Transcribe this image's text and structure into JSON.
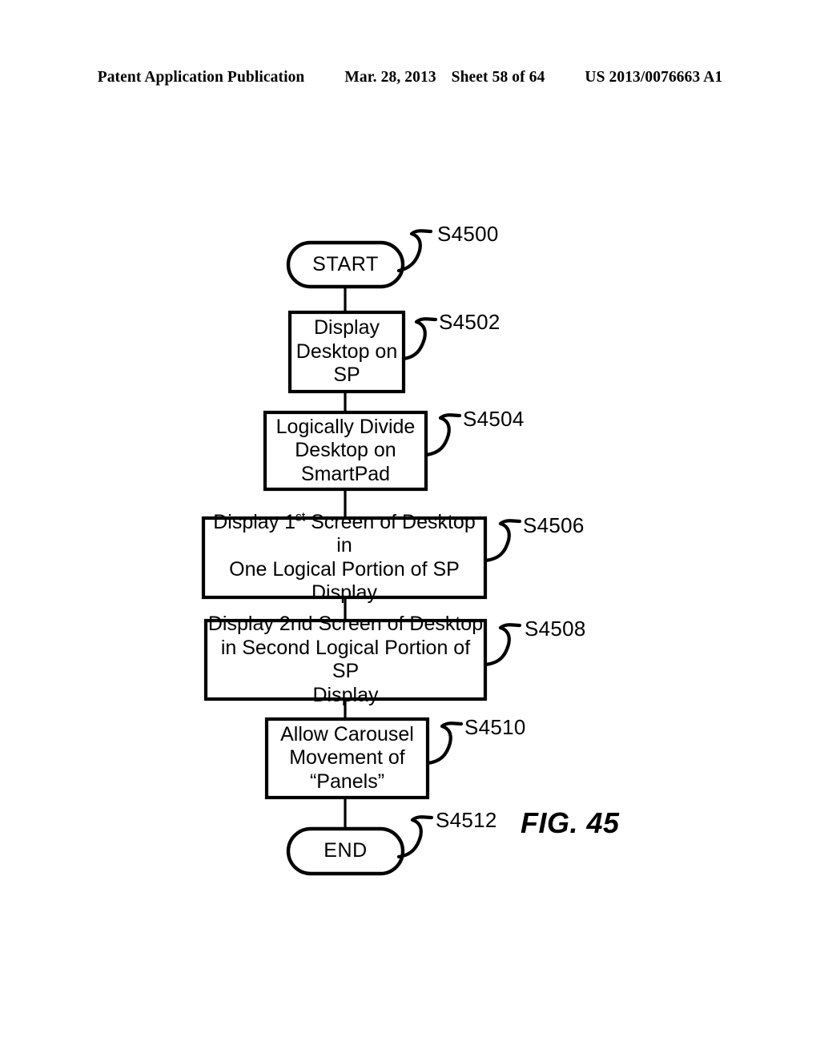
{
  "header": {
    "publication": "Patent Application Publication",
    "date": "Mar. 28, 2013",
    "sheet": "Sheet 58 of 64",
    "pub_number": "US 2013/0076663 A1"
  },
  "figure": {
    "caption": "FIG. 45",
    "ink_color": "#000000",
    "background_color": "#ffffff"
  },
  "flowchart": {
    "nodes": [
      {
        "id": "S4500",
        "shape": "terminal",
        "label": "START",
        "ref": "S4500"
      },
      {
        "id": "S4502",
        "shape": "process",
        "label": "Display Desktop on SP",
        "lines": [
          "Display",
          "Desktop on",
          "SP"
        ],
        "ref": "S4502"
      },
      {
        "id": "S4504",
        "shape": "process",
        "label": "Logically Divide Desktop on SmartPad",
        "lines": [
          "Logically Divide",
          "Desktop on",
          "SmartPad"
        ],
        "ref": "S4504"
      },
      {
        "id": "S4506",
        "shape": "process",
        "label": "Display 1st Screen of Desktop in One Logical Portion of SP Display",
        "lines_html": [
          "Display 1<sup>st</sup> Screen of Desktop in",
          "One Logical Portion of SP",
          "Display"
        ],
        "ref": "S4506"
      },
      {
        "id": "S4508",
        "shape": "process",
        "label": "Display 2nd Screen of Desktop in Second Logical Portion of SP Display",
        "lines": [
          "Display 2nd Screen of Desktop",
          "in Second Logical Portion of SP",
          "Display"
        ],
        "ref": "S4508"
      },
      {
        "id": "S4510",
        "shape": "process",
        "label": "Allow Carousel Movement of “Panels”",
        "lines": [
          "Allow Carousel",
          "Movement of",
          "“Panels”"
        ],
        "ref": "S4510"
      },
      {
        "id": "S4512",
        "shape": "terminal",
        "label": "END",
        "ref": "S4512"
      }
    ],
    "connectors": [
      {
        "from": "S4500",
        "to": "S4502"
      },
      {
        "from": "S4502",
        "to": "S4504"
      },
      {
        "from": "S4504",
        "to": "S4506"
      },
      {
        "from": "S4506",
        "to": "S4508"
      },
      {
        "from": "S4508",
        "to": "S4510"
      },
      {
        "from": "S4510",
        "to": "S4512"
      }
    ]
  }
}
